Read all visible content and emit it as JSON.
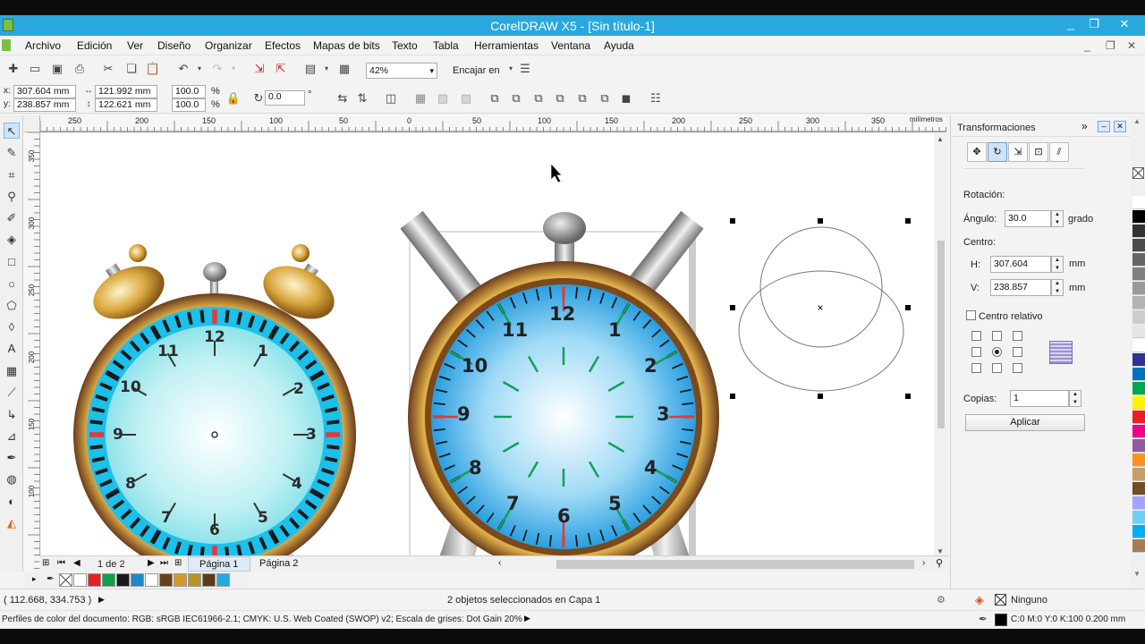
{
  "window": {
    "title": "CorelDRAW X5 - [Sin título-1]"
  },
  "menu": [
    "Archivo",
    "Edición",
    "Ver",
    "Diseño",
    "Organizar",
    "Efectos",
    "Mapas de bits",
    "Texto",
    "Tabla",
    "Herramientas",
    "Ventana",
    "Ayuda"
  ],
  "toolbar": {
    "zoom": "42%",
    "snap_label": "Encajar en"
  },
  "propbar": {
    "x_label": "x:",
    "x": "307.604 mm",
    "y_label": "y:",
    "y": "238.857 mm",
    "w": "121.992 mm",
    "h": "122.621 mm",
    "scale_x": "100.0",
    "scale_y": "100.0",
    "pct": "%",
    "angle": "0.0",
    "angle_unit": "°"
  },
  "ruler": {
    "top_ticks": [
      "250",
      "200",
      "150",
      "100",
      "50",
      "0",
      "50",
      "100",
      "150",
      "200",
      "250",
      "300",
      "350"
    ],
    "unit": "milímetros",
    "left_ticks": [
      "350",
      "300",
      "250",
      "200",
      "150",
      "100"
    ]
  },
  "clock1": {
    "numbers": [
      "12",
      "1",
      "2",
      "3",
      "4",
      "5",
      "6",
      "7",
      "8",
      "9",
      "10",
      "11"
    ]
  },
  "clock2": {
    "numbers": [
      "12",
      "1",
      "2",
      "3",
      "4",
      "5",
      "6",
      "7",
      "8",
      "9",
      "10",
      "11"
    ]
  },
  "pagebar": {
    "count": "1 de 2",
    "page1": "Página 1",
    "page2": "Página 2"
  },
  "docker": {
    "title": "Transformaciones",
    "section": "Rotación:",
    "angle_label": "Ángulo:",
    "angle": "30.0",
    "angle_unit": "grado",
    "center_label": "Centro:",
    "h_label": "H:",
    "h": "307.604",
    "h_unit": "mm",
    "v_label": "V:",
    "v": "238.857",
    "v_unit": "mm",
    "relative_label": "Centro relativo",
    "copies_label": "Copias:",
    "copies": "1",
    "apply": "Aplicar"
  },
  "status": {
    "coords": "( 112.668, 334.753 )",
    "selection": "2 objetos seleccionados en Capa 1",
    "fill": "Ninguno",
    "outline": "C:0 M:0 Y:0 K:100  0.200 mm",
    "profile": "Perfiles de color del documento: RGB: sRGB IEC61966-2.1; CMYK: U.S. Web Coated (SWOP) v2; Escala de grises: Dot Gain 20%"
  },
  "colors": {
    "titlebar": "#2aa8dd",
    "palette_bottom": [
      "#ffffff",
      "#e32322",
      "#0fa14a",
      "#1a1a1a",
      "#1e88c9",
      "#ffffff",
      "#6a3d1c",
      "#d29a2a",
      "#b8922a",
      "#5b3a1e",
      "#26a9e0"
    ],
    "palette_right": [
      "#ffffff",
      "#000000",
      "#333333",
      "#4d4d4d",
      "#666666",
      "#808080",
      "#999999",
      "#b3b3b3",
      "#cccccc",
      "#e6e6e6",
      "#ffffff",
      "#2e3192",
      "#0072bc",
      "#00a651",
      "#fff200",
      "#ed1c24",
      "#ec008c",
      "#8e5ba1",
      "#f7941d",
      "#c69c6d",
      "#754c24",
      "#a3a3ff",
      "#6dcff6",
      "#00aeef",
      "#a67c52"
    ]
  }
}
